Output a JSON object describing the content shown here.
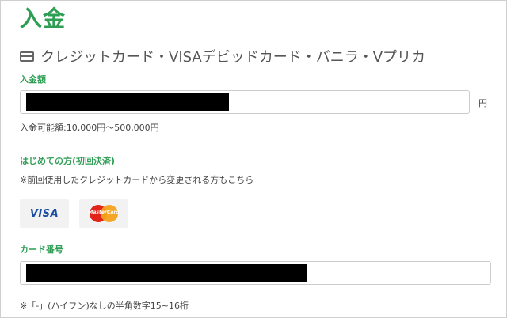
{
  "page": {
    "title": "入金"
  },
  "section": {
    "icon": "credit-card-icon",
    "heading": "クレジットカード・VISAデビッドカード・バニラ・Vプリカ"
  },
  "deposit": {
    "label": "入金額",
    "unit": "円",
    "range_note": "入金可能額:10,000円〜500,000円"
  },
  "first_time": {
    "label": "はじめての方(初回決済)",
    "note": "※前回使用したクレジットカードから変更される方もこちら"
  },
  "brands": {
    "visa": "VISA",
    "mastercard": "MasterCard"
  },
  "card_number": {
    "label": "カード番号",
    "note": "※「-」(ハイフン)なしの半角数字15~16桁"
  },
  "colors": {
    "accent": "#2f9e55",
    "redaction": "#000000"
  }
}
